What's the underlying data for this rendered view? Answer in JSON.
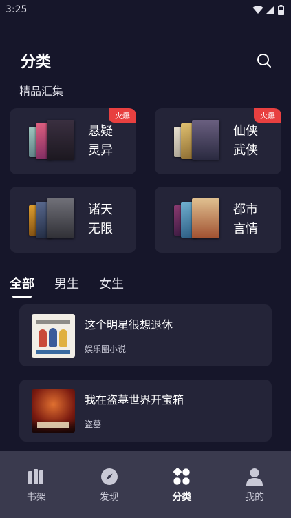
{
  "status_bar": {
    "time": "3:25"
  },
  "header": {
    "title": "分类"
  },
  "section": {
    "title": "精品汇集"
  },
  "categories": [
    {
      "name": "悬疑灵异",
      "badge": "火爆",
      "book_colors": [
        "#8fb4b0",
        "#c94a6a",
        "#2a2530"
      ]
    },
    {
      "name": "仙侠武侠",
      "badge": "火爆",
      "book_colors": [
        "#d8d0c0",
        "#c9a760",
        "#4c4560"
      ]
    },
    {
      "name": "诸天无限",
      "badge": "",
      "book_colors": [
        "#c98a2a",
        "#3a4a70",
        "#55555c"
      ]
    },
    {
      "name": "都市言情",
      "badge": "",
      "book_colors": [
        "#6a2a5a",
        "#4a8ab0",
        "#d8b080"
      ]
    }
  ],
  "tabs": [
    {
      "label": "全部",
      "active": true
    },
    {
      "label": "男生",
      "active": false
    },
    {
      "label": "女生",
      "active": false
    }
  ],
  "books": [
    {
      "title": "这个明星很想退休",
      "tag": "娱乐圈小说"
    },
    {
      "title": "我在盗墓世界开宝箱",
      "tag": "盗墓"
    }
  ],
  "bottom_nav": [
    {
      "label": "书架",
      "icon": "bookshelf-icon",
      "active": false
    },
    {
      "label": "发现",
      "icon": "compass-icon",
      "active": false
    },
    {
      "label": "分类",
      "icon": "category-icon",
      "active": true
    },
    {
      "label": "我的",
      "icon": "user-icon",
      "active": false
    }
  ],
  "colors": {
    "background": "#16162a",
    "card": "#242438",
    "badge": "#e84040",
    "nav": "#3a3a4e"
  }
}
